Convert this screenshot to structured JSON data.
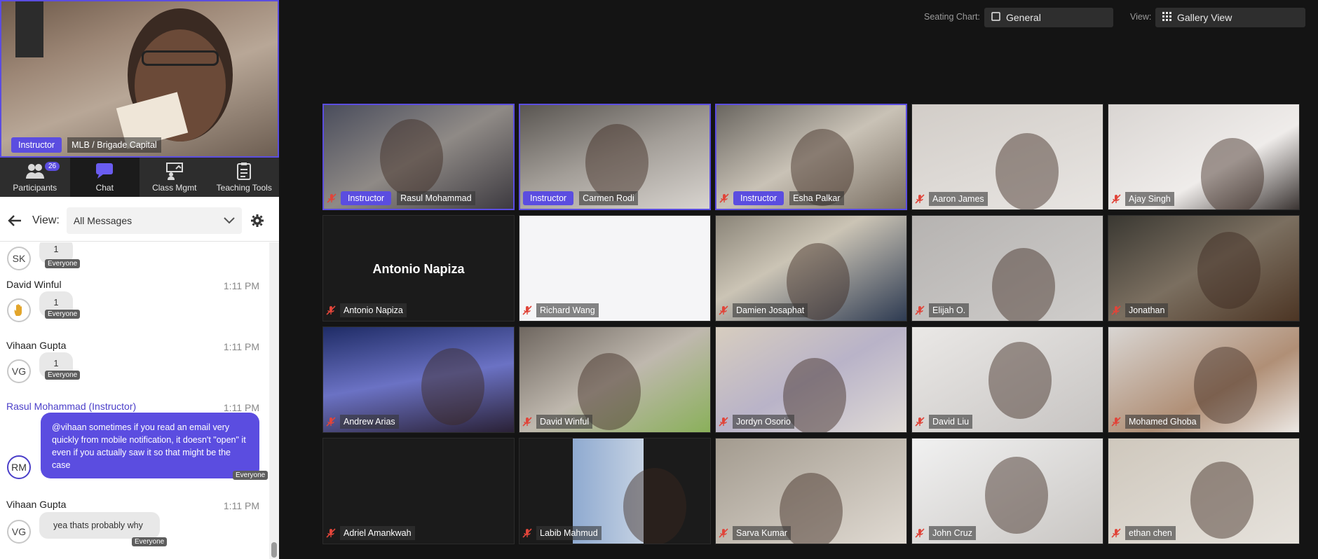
{
  "self_view": {
    "role": "Instructor",
    "name": "MLB / Brigade Capital"
  },
  "tabs": [
    {
      "label": "Participants",
      "badge": "26",
      "icon": "participants-icon"
    },
    {
      "label": "Chat",
      "icon": "chat-icon"
    },
    {
      "label": "Class Mgmt",
      "icon": "class-mgmt-icon"
    },
    {
      "label": "Teaching Tools",
      "icon": "teaching-tools-icon"
    }
  ],
  "chat_view": {
    "label": "View:",
    "selected": "All Messages"
  },
  "chat": {
    "audience": "Everyone",
    "messages": [
      {
        "avatar": "SK",
        "text": "1"
      },
      {
        "sender": "David Winful",
        "time": "1:11 PM",
        "avatar": "",
        "text": "1"
      },
      {
        "sender": "Vihaan Gupta",
        "time": "1:11 PM",
        "avatar": "VG",
        "text": "1"
      },
      {
        "sender": "Rasul Mohammad (Instructor)",
        "time": "1:11 PM",
        "avatar": "RM",
        "text": "@vihaan sometimes if you read an email very quickly from mobile notification, it doesn't \"open\" it even if you actually saw it so that might be the case"
      },
      {
        "sender": "Vihaan Gupta",
        "time": "1:11 PM",
        "avatar": "VG",
        "text": "yea thats probably why"
      }
    ]
  },
  "topbar": {
    "seating_label": "Seating Chart:",
    "seating_value": "General",
    "view_label": "View:",
    "view_value": "Gallery View"
  },
  "gallery": [
    {
      "name": "Rasul Mohammad",
      "role": "Instructor",
      "muted": true,
      "highlight": true
    },
    {
      "name": "Carmen Rodi",
      "role": "Instructor",
      "muted": false,
      "highlight": true
    },
    {
      "name": "Esha Palkar",
      "role": "Instructor",
      "muted": true,
      "highlight": true
    },
    {
      "name": "Aaron James",
      "muted": true
    },
    {
      "name": "Ajay Singh",
      "muted": true
    },
    {
      "name": "Antonio Napiza",
      "muted": true,
      "video_off": true
    },
    {
      "name": "Richard Wang",
      "muted": true
    },
    {
      "name": "Damien Josaphat",
      "muted": true
    },
    {
      "name": "Elijah O.",
      "muted": true
    },
    {
      "name": "Jonathan",
      "muted": true
    },
    {
      "name": "Andrew Arias",
      "muted": true
    },
    {
      "name": "David Winful",
      "muted": true
    },
    {
      "name": "Jordyn Osorio",
      "muted": true
    },
    {
      "name": "David Liu",
      "muted": true
    },
    {
      "name": "Mohamed Ghoba",
      "muted": true
    },
    {
      "name": "Adriel Amankwah",
      "muted": true
    },
    {
      "name": "Labib Mahmud",
      "muted": true
    },
    {
      "name": "Sarva Kumar",
      "muted": true
    },
    {
      "name": "John Cruz",
      "muted": true
    },
    {
      "name": "ethan chen",
      "muted": true
    }
  ],
  "colors": {
    "accent": "#5b4de0",
    "mute": "#e0453a"
  }
}
